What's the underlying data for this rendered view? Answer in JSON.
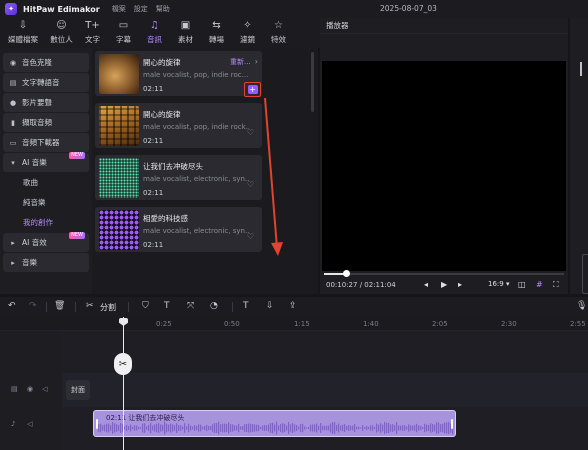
{
  "app": {
    "name": "HitPaw Edimakor",
    "logo_glyph": "✦"
  },
  "menu": [
    "檔案",
    "設定",
    "幫助"
  ],
  "document_title": "2025-08-07_03",
  "toolbar": [
    {
      "label": "媒體檔案",
      "glyph": "⇩",
      "icon": "import-icon"
    },
    {
      "label": "數位人",
      "glyph": "☺",
      "icon": "avatar-icon"
    },
    {
      "label": "文字",
      "glyph": "T+",
      "icon": "text-icon"
    },
    {
      "label": "字幕",
      "glyph": "▭",
      "icon": "subtitle-icon"
    },
    {
      "label": "音訊",
      "glyph": "♫",
      "icon": "music-icon"
    },
    {
      "label": "素材",
      "glyph": "▣",
      "icon": "sticker-icon"
    },
    {
      "label": "轉場",
      "glyph": "⇆",
      "icon": "transition-icon"
    },
    {
      "label": "濾鏡",
      "glyph": "✧",
      "icon": "filter-icon"
    },
    {
      "label": "特效",
      "glyph": "☆",
      "icon": "effects-icon"
    }
  ],
  "sidebar": {
    "items": [
      {
        "label": "音色克隆",
        "glyph": "◉",
        "type": "section"
      },
      {
        "label": "文字轉語音",
        "glyph": "▤",
        "type": "section"
      },
      {
        "label": "影片要聲",
        "glyph": "●",
        "type": "section"
      },
      {
        "label": "擷取音頻",
        "glyph": "▮",
        "type": "section"
      },
      {
        "label": "音頻下載器",
        "glyph": "▭",
        "type": "section"
      },
      {
        "label": "AI 音樂",
        "glyph": "▾",
        "type": "section",
        "badge": "NEW"
      },
      {
        "label": "歌曲",
        "type": "sub"
      },
      {
        "label": "純音樂",
        "type": "sub"
      },
      {
        "label": "我的創作",
        "type": "sub",
        "active": true
      },
      {
        "label": "AI 音效",
        "glyph": "▸",
        "type": "section",
        "badge": "NEW"
      },
      {
        "label": "音樂",
        "glyph": "▸",
        "type": "section"
      }
    ]
  },
  "media": {
    "cards": [
      {
        "title": "開心的旋律",
        "desc": "male vocalist, pop, indie roc...",
        "duration": "02:11",
        "renew": "重新...",
        "thumb": "wood",
        "show_add": true
      },
      {
        "title": "開心的旋律",
        "desc": "male vocalist, pop, indie rock...",
        "duration": "02:11",
        "thumb": "mosaic"
      },
      {
        "title": "让我们去冲破尽头",
        "desc": "male vocalist, electronic, syn...",
        "duration": "02:11",
        "thumb": "dots-green"
      },
      {
        "title": "相愛的科技感",
        "desc": "male vocalist, electronic, syn...",
        "duration": "02:11",
        "thumb": "dots-purple"
      }
    ]
  },
  "player": {
    "header": "播放器",
    "current_time": "00:10:27",
    "total_time": "02:11:04",
    "time_sep": "/",
    "aspect": "16:9",
    "progress": 0.09
  },
  "timeline": {
    "split_label": "分割",
    "ticks": [
      "0:25",
      "0:50",
      "1:15",
      "1:40",
      "2:05",
      "2:30",
      "2:55"
    ],
    "cover_label": "封面",
    "audio_clip_label": "02:11  让我们去冲破尽头"
  },
  "colors": {
    "accent": "#b68cff",
    "highlight_box": "#e0442e",
    "clip": "#a792dc",
    "annotation_arrow": "#e0442e"
  }
}
